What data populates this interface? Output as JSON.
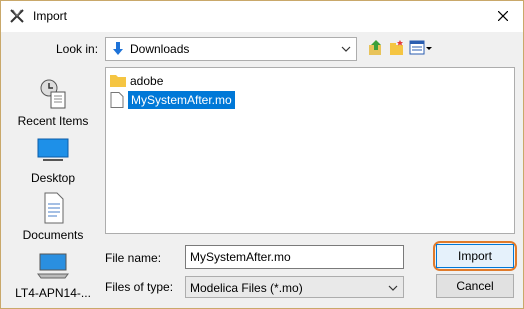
{
  "window": {
    "title": "Import"
  },
  "toolbar": {
    "look_in_label": "Look in:",
    "look_in_value": "Downloads"
  },
  "places": [
    {
      "label": "Recent Items",
      "icon": "recent-items-icon"
    },
    {
      "label": "Desktop",
      "icon": "desktop-icon"
    },
    {
      "label": "Documents",
      "icon": "documents-icon"
    },
    {
      "label": "LT4-APN14-...",
      "icon": "computer-icon"
    }
  ],
  "files": [
    {
      "name": "adobe",
      "type": "folder"
    },
    {
      "name": "MySystemAfter.mo",
      "type": "file",
      "selected": true
    }
  ],
  "form": {
    "file_name_label": "File name:",
    "file_name_value": "MySystemAfter.mo",
    "files_of_type_label": "Files of type:",
    "files_of_type_value": "Modelica Files (*.mo)"
  },
  "buttons": {
    "import": "Import",
    "cancel": "Cancel"
  },
  "colors": {
    "selection": "#0078d7",
    "focus_ring": "#e07a2a",
    "folder": "#f5c542"
  }
}
